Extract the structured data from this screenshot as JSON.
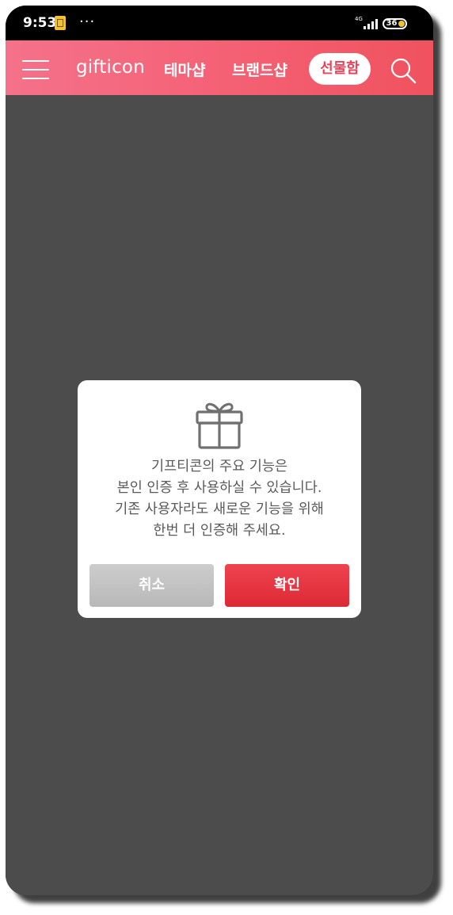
{
  "status_bar": {
    "time": "9:53",
    "overflow": "···",
    "network": "4G",
    "battery": "36",
    "icons": [
      "sim-notification-icon",
      "signal-icon",
      "battery-icon"
    ]
  },
  "header": {
    "logo": "gifticon",
    "nav": [
      "테마샵",
      "브랜드샵",
      "선물함"
    ],
    "active_nav": "선물함",
    "icons": [
      "menu-icon",
      "search-icon"
    ]
  },
  "dialog": {
    "icon": "gift-icon",
    "message": [
      "기프티콘의 주요 기능은",
      "본인 인증 후 사용하실 수 있습니다.",
      "기존 사용자라도 새로운 기능을 위해",
      "한번 더 인증해 주세요."
    ],
    "cancel_label": "취소",
    "confirm_label": "확인"
  },
  "colors": {
    "header_gradient": [
      "#f4728a",
      "#f0525e"
    ],
    "overlay": "#4c4c4c",
    "confirm": "#e5343f",
    "cancel": "#c2c2c2"
  }
}
